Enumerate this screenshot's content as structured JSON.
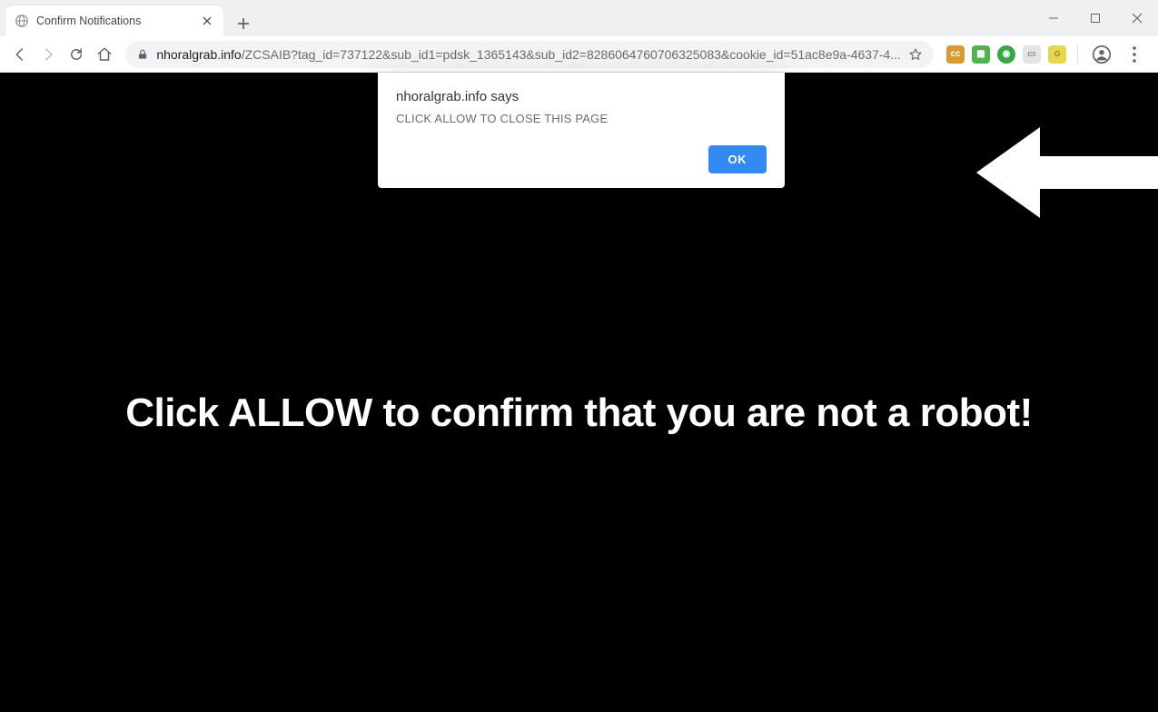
{
  "window": {
    "tab_title": "Confirm Notifications"
  },
  "address": {
    "host": "nhoralgrab.info",
    "path": "/ZCSAIB?tag_id=737122&sub_id1=pdsk_1365143&sub_id2=8286064760706325083&cookie_id=51ac8e9a-4637-4..."
  },
  "extensions": {
    "e1_bg": "#d79b2f",
    "e1_tx": "cc",
    "e2_bg": "#54b24e",
    "e2_tx": "▦",
    "e3_bg": "#3aa648",
    "e3_tx": "◉",
    "e4_bg": "#e4e4e4",
    "e4_tx": "▭",
    "e5_bg": "#e9d84d",
    "e5_tx": "☺"
  },
  "dialog": {
    "origin": "nhoralgrab.info says",
    "message": "CLICK ALLOW TO CLOSE THIS PAGE",
    "ok_label": "OK"
  },
  "page": {
    "headline": "Click ALLOW to confirm that you are not a robot!"
  }
}
